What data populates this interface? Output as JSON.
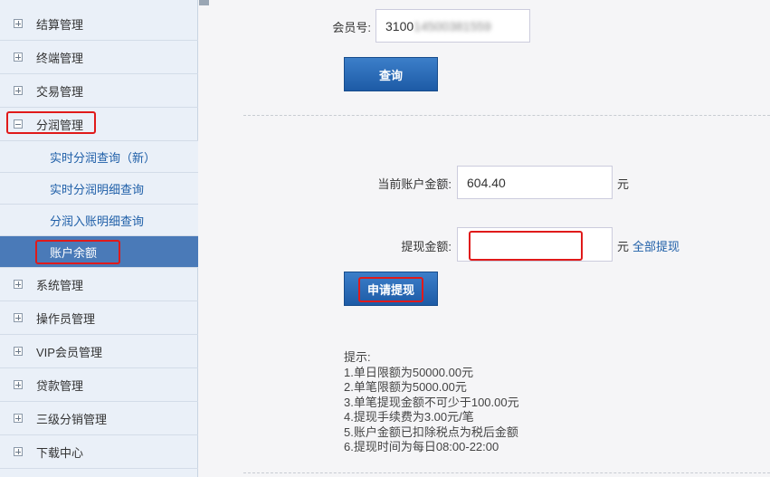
{
  "sidebar": {
    "items": [
      {
        "label": "结算管理",
        "expanded": false
      },
      {
        "label": "终端管理",
        "expanded": false
      },
      {
        "label": "交易管理",
        "expanded": false
      },
      {
        "label": "分润管理",
        "expanded": true
      },
      {
        "label": "系统管理",
        "expanded": false
      },
      {
        "label": "操作员管理",
        "expanded": false
      },
      {
        "label": "VIP会员管理",
        "expanded": false
      },
      {
        "label": "贷款管理",
        "expanded": false
      },
      {
        "label": "三级分销管理",
        "expanded": false
      },
      {
        "label": "下载中心",
        "expanded": false
      }
    ],
    "subitems": [
      {
        "label": "实时分润查询（新）"
      },
      {
        "label": "实时分润明细查询"
      },
      {
        "label": "分润入账明细查询"
      },
      {
        "label": "账户余额",
        "active": true
      }
    ]
  },
  "query": {
    "member_label": "会员号:",
    "member_prefix": "3100",
    "member_redacted": "14500381559",
    "button": "查询"
  },
  "balance": {
    "label": "当前账户金额:",
    "value": "604.40",
    "unit": "元"
  },
  "withdraw": {
    "label": "提现金额:",
    "value": "",
    "unit": "元",
    "all_link": "全部提现",
    "button": "申请提现"
  },
  "tips": {
    "title": "提示:",
    "lines": [
      "1.单日限额为50000.00元",
      "2.单笔限额为5000.00元",
      "3.单笔提现金额不可少于100.00元",
      "4.提现手续费为3.00元/笔",
      "5.账户金额已扣除税点为税后金额",
      "6.提现时间为每日08:00-22:00"
    ]
  },
  "colors": {
    "accent": "#1f5fa8",
    "button": "#2a6bb8",
    "highlight": "#e01a1a",
    "active_menu": "#4a7ab8"
  }
}
